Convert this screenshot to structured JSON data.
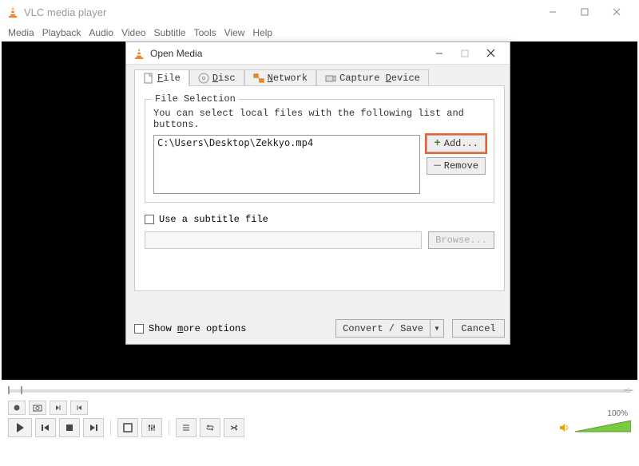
{
  "window": {
    "title": "VLC media player",
    "menus": [
      "Media",
      "Playback",
      "Audio",
      "Video",
      "Subtitle",
      "Tools",
      "View",
      "Help"
    ]
  },
  "dialog": {
    "title": "Open Media",
    "tabs": {
      "file": "File",
      "disc": "Disc",
      "network": "Network",
      "capture": "Capture Device"
    },
    "file_selection_legend": "File Selection",
    "file_selection_text": "You can select local files with the following list and buttons.",
    "files": [
      "C:\\Users\\Desktop\\Zekkyo.mp4"
    ],
    "add_label": "Add...",
    "remove_label": "Remove",
    "use_subtitle_label": "Use a subtitle file",
    "browse_label": "Browse...",
    "show_more_label": "Show more options",
    "convert_label": "Convert / Save",
    "cancel_label": "Cancel"
  },
  "volume": {
    "label": "100%"
  }
}
